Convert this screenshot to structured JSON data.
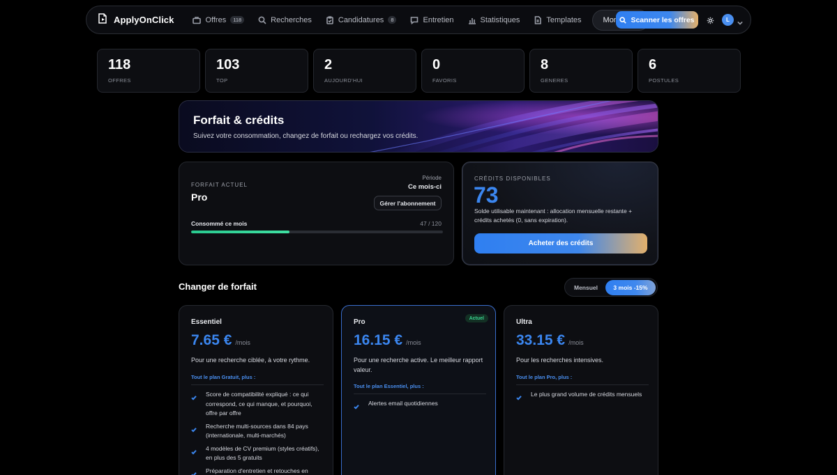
{
  "brand": {
    "name": "ApplyOnClick",
    "icon": "document-send-icon"
  },
  "nav": {
    "items": [
      {
        "label": "Offres",
        "icon": "briefcase-icon",
        "badge": "118"
      },
      {
        "label": "Recherches",
        "icon": "search-icon"
      },
      {
        "label": "Candidatures",
        "icon": "clipboard-icon",
        "badge": "8"
      },
      {
        "label": "Entretien",
        "icon": "chat-icon"
      },
      {
        "label": "Statistiques",
        "icon": "bar-chart-icon"
      },
      {
        "label": "Templates",
        "icon": "file-icon"
      },
      {
        "label": "Mon Profil",
        "icon": "user-icon"
      }
    ],
    "scan_button": "Scanner les offres",
    "avatar_initial": "L"
  },
  "stats": [
    {
      "value": "118",
      "label": "OFFRES"
    },
    {
      "value": "103",
      "label": "TOP"
    },
    {
      "value": "2",
      "label": "AUJOURD'HUI"
    },
    {
      "value": "0",
      "label": "FAVORIS"
    },
    {
      "value": "8",
      "label": "GENERES"
    },
    {
      "value": "6",
      "label": "POSTULES"
    }
  ],
  "hero": {
    "title": "Forfait & crédits",
    "subtitle": "Suivez votre consommation, changez de forfait ou rechargez vos crédits."
  },
  "current_plan": {
    "label": "FORFAIT ACTUEL",
    "name": "Pro",
    "period_label": "Période",
    "period_value": "Ce mois-ci",
    "manage_button": "Gérer l'abonnement",
    "consumed_label": "Consommé ce mois",
    "consumed_text": "47 / 120",
    "consumed": 47,
    "quota": 120
  },
  "credits": {
    "label": "CRÉDITS DISPONIBLES",
    "value": "73",
    "description": "Solde utilisable maintenant : allocation mensuelle restante + crédits achetés (0, sans expiration).",
    "buy_button": "Acheter des crédits"
  },
  "change_plan": {
    "title": "Changer de forfait",
    "toggle": {
      "monthly": "Mensuel",
      "quarterly": "3 mois -15%",
      "selected": "quarterly"
    }
  },
  "tiers": [
    {
      "name": "Essentiel",
      "amount": "7.65 €",
      "per": "/mois",
      "description": "Pour une recherche ciblée, à votre rythme.",
      "inherit": "Tout le plan Gratuit, plus :",
      "features": [
        "Score de compatibilité expliqué : ce qui correspond, ce qui manque, et pourquoi, offre par offre",
        "Recherche multi-sources dans 84 pays (internationale, multi-marchés)",
        "4 modèles de CV premium (styles créatifs), en plus des 5 gratuits",
        "Préparation d'entretien et retouches en"
      ]
    },
    {
      "name": "Pro",
      "badge": "Actuel",
      "amount": "16.15 €",
      "per": "/mois",
      "description": "Pour une recherche active. Le meilleur rapport valeur.",
      "inherit": "Tout le plan Essentiel, plus :",
      "features": [
        "Alertes email quotidiennes"
      ]
    },
    {
      "name": "Ultra",
      "amount": "33.15 €",
      "per": "/mois",
      "description": "Pour les recherches intensives.",
      "inherit": "Tout le plan Pro, plus :",
      "features": [
        "Le plus grand volume de crédits mensuels"
      ]
    }
  ],
  "colors": {
    "accent": "#3b86ef",
    "gold": "#e4b06a",
    "progress": "#29c98f",
    "badge_green": "#39d28f"
  }
}
